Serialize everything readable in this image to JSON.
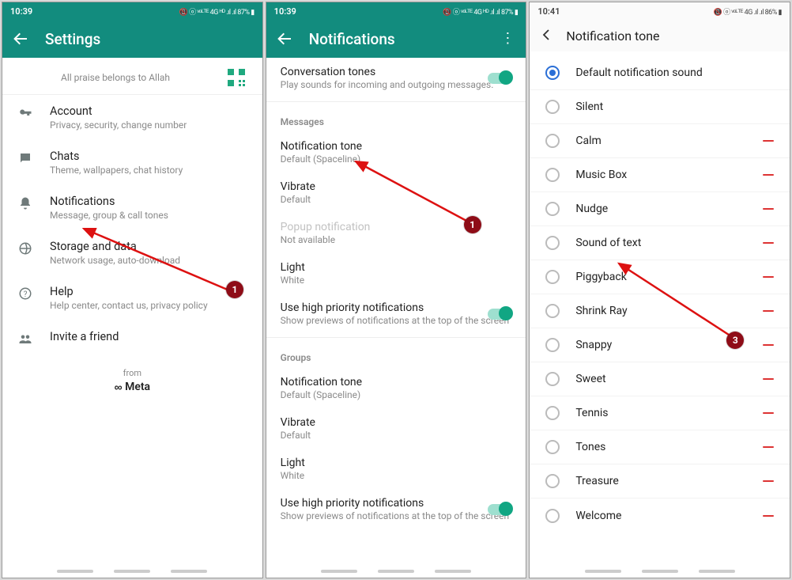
{
  "screen1": {
    "statusbar": {
      "time": "10:39",
      "right": "📵 ⓞ ᵛᵒᴸᵀᴱ 4G ᴴᴰ .ıl .ıl 87% ▮"
    },
    "appbar_title": "Settings",
    "profile_status": "All praise belongs to Allah",
    "items": [
      {
        "title": "Account",
        "sub": "Privacy, security, change number",
        "icon": "key"
      },
      {
        "title": "Chats",
        "sub": "Theme, wallpapers, chat history",
        "icon": "chat"
      },
      {
        "title": "Notifications",
        "sub": "Message, group & call tones",
        "icon": "bell"
      },
      {
        "title": "Storage and data",
        "sub": "Network usage, auto-download",
        "icon": "data"
      },
      {
        "title": "Help",
        "sub": "Help center, contact us, privacy policy",
        "icon": "help"
      },
      {
        "title": "Invite a friend",
        "sub": "",
        "icon": "group"
      }
    ],
    "footer_from": "from",
    "footer_meta": "Meta",
    "callout": "1"
  },
  "screen2": {
    "statusbar": {
      "time": "10:39",
      "right": "📵 ⓞ ᵛᵒᴸᵀᴱ 4G ᴴᴰ .ıl .ıl 87% ▮"
    },
    "appbar_title": "Notifications",
    "conversation_tones": {
      "title": "Conversation tones",
      "sub": "Play sounds for incoming and outgoing messages."
    },
    "section_messages": "Messages",
    "messages": {
      "notification_tone": {
        "title": "Notification tone",
        "sub": "Default (Spaceline)"
      },
      "vibrate": {
        "title": "Vibrate",
        "sub": "Default"
      },
      "popup": {
        "title": "Popup notification",
        "sub": "Not available"
      },
      "light": {
        "title": "Light",
        "sub": "White"
      },
      "high_priority": {
        "title": "Use high priority notifications",
        "sub": "Show previews of notifications at the top of the screen"
      }
    },
    "section_groups": "Groups",
    "groups": {
      "notification_tone": {
        "title": "Notification tone",
        "sub": "Default (Spaceline)"
      },
      "vibrate": {
        "title": "Vibrate",
        "sub": "Default"
      },
      "light": {
        "title": "Light",
        "sub": "White"
      },
      "high_priority": {
        "title": "Use high priority notifications",
        "sub": "Show previews of notifications at the top of the screen"
      }
    },
    "callout": "1"
  },
  "screen3": {
    "statusbar": {
      "time": "10:41",
      "right": "📵 ⓞ ᵛᵒᴸᵀᴱ 4G .ıl .ıl 86% ▮"
    },
    "appbar_title": "Notification tone",
    "tones": [
      {
        "label": "Default notification sound",
        "selected": true,
        "dash": false
      },
      {
        "label": "Silent",
        "selected": false,
        "dash": false
      },
      {
        "label": "Calm",
        "selected": false,
        "dash": true
      },
      {
        "label": "Music Box",
        "selected": false,
        "dash": true
      },
      {
        "label": "Nudge",
        "selected": false,
        "dash": true
      },
      {
        "label": "Sound of text",
        "selected": false,
        "dash": true
      },
      {
        "label": "Piggyback",
        "selected": false,
        "dash": true
      },
      {
        "label": "Shrink Ray",
        "selected": false,
        "dash": true
      },
      {
        "label": "Snappy",
        "selected": false,
        "dash": true
      },
      {
        "label": "Sweet",
        "selected": false,
        "dash": true
      },
      {
        "label": "Tennis",
        "selected": false,
        "dash": true
      },
      {
        "label": "Tones",
        "selected": false,
        "dash": true
      },
      {
        "label": "Treasure",
        "selected": false,
        "dash": true
      },
      {
        "label": "Welcome",
        "selected": false,
        "dash": true
      }
    ],
    "callout": "3"
  }
}
